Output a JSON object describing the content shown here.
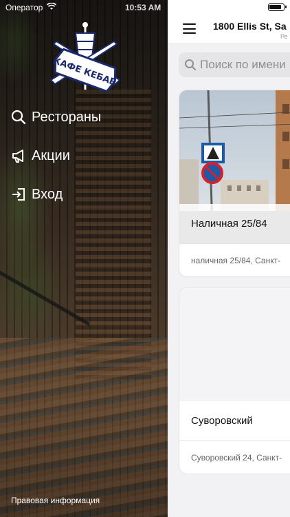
{
  "status_bar": {
    "carrier": "Оператор",
    "time": "10:53 AM"
  },
  "drawer": {
    "logo_text": "КАФЕ КЕБАБ",
    "menu": [
      {
        "label": "Рестораны",
        "icon": "search-icon"
      },
      {
        "label": "Акции",
        "icon": "megaphone-icon"
      },
      {
        "label": "Вход",
        "icon": "login-icon"
      }
    ],
    "legal_link": "Правовая информация"
  },
  "main": {
    "address": "1800 Ellis St, Sa",
    "address_sub": "Ре",
    "search_placeholder": "Поиск по имени",
    "restaurants": [
      {
        "name": "Наличная 25/84",
        "address": "наличная 25/84, Санкт-"
      },
      {
        "name": "Суворовский",
        "address": "Суворовский 24, Санкт-"
      }
    ]
  },
  "colors": {
    "accent_navy": "#1a2a6c",
    "search_bg": "#e5e5e8",
    "panel_bg": "#f2f2f4"
  }
}
